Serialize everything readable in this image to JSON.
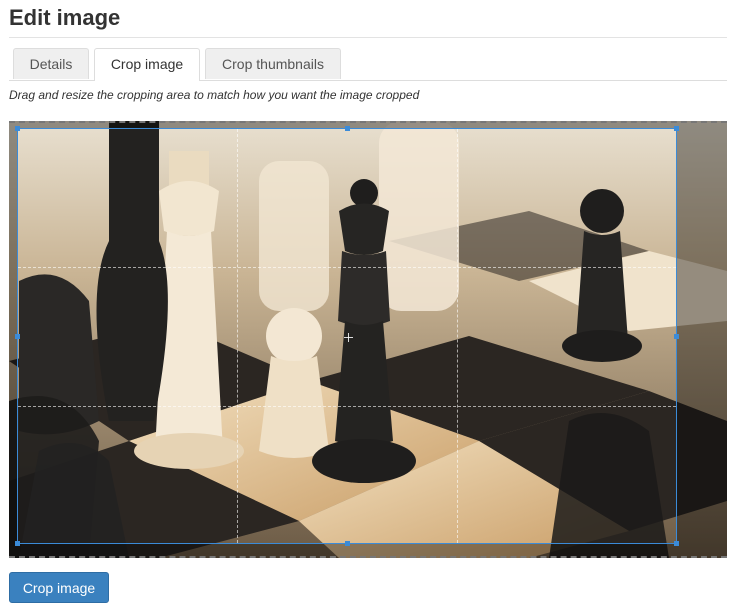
{
  "page": {
    "title": "Edit image"
  },
  "tabs": [
    {
      "label": "Details",
      "active": false
    },
    {
      "label": "Crop image",
      "active": true
    },
    {
      "label": "Crop thumbnails",
      "active": false
    }
  ],
  "hint": "Drag and resize the cropping area to match how you want the image cropped",
  "image": {
    "description_icon": "chess-photo"
  },
  "actions": {
    "crop_label": "Crop image"
  },
  "colors": {
    "accent": "#3a81bf",
    "crop_border": "#3b8bd8"
  }
}
